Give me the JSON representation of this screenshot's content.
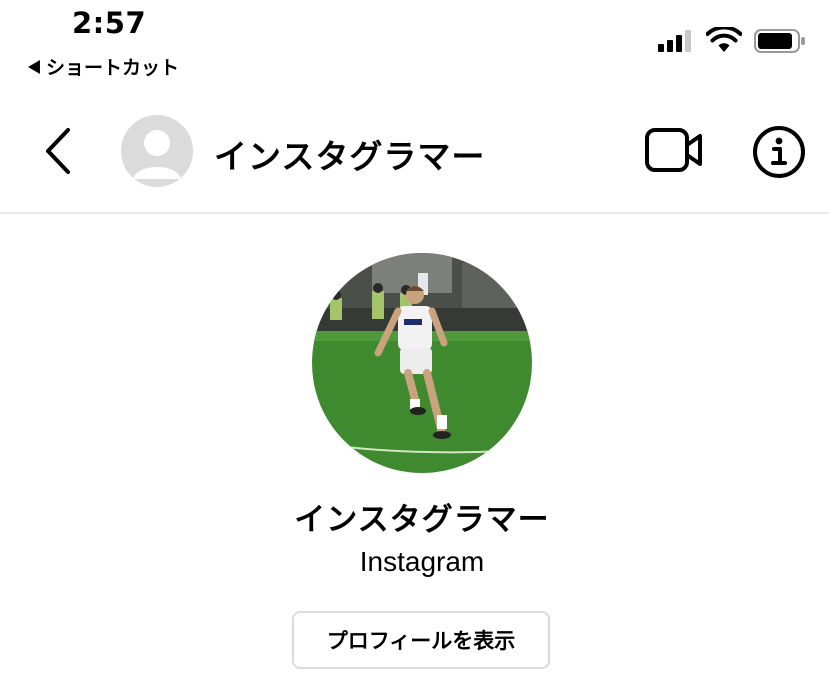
{
  "status_bar": {
    "time": "2:57",
    "back_app_label": "ショートカット"
  },
  "header": {
    "username": "インスタグラマー",
    "icons": {
      "back": "chevron-left-icon",
      "video": "video-camera-icon",
      "info": "info-icon"
    }
  },
  "profile": {
    "name": "インスタグラマー",
    "subtitle": "Instagram",
    "view_profile_label": "プロフィールを表示",
    "photo": "soccer-player-photo"
  },
  "colors": {
    "divider": "#ececec",
    "avatar_placeholder": "#dbdbdb",
    "button_border": "#dbdbdb",
    "pitch_green": "#3f8a2e"
  }
}
